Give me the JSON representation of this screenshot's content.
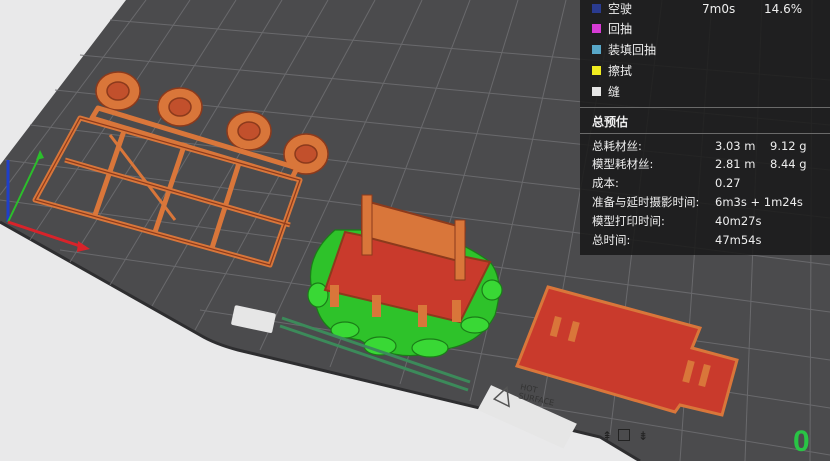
{
  "legend": {
    "items": [
      {
        "label": "空驶",
        "time": "7m0s",
        "percent": "14.6%",
        "color": "#2a3b8f"
      },
      {
        "label": "回抽",
        "color": "#d63bd4"
      },
      {
        "label": "装填回抽",
        "color": "#58a7c8"
      },
      {
        "label": "擦拭",
        "color": "#f0ec20"
      },
      {
        "label": "缝",
        "color": "#e6e6e6"
      }
    ]
  },
  "estimate": {
    "title": "总预估",
    "rows": [
      {
        "label": "总耗材丝:",
        "value1": "3.03 m",
        "value2": "9.12 g"
      },
      {
        "label": "模型耗材丝:",
        "value1": "2.81 m",
        "value2": "8.44 g"
      },
      {
        "label": "成本:",
        "value1": "0.27",
        "value2": ""
      },
      {
        "label": "准备与延时摄影时间:",
        "value1": "6m3s + 1m24s",
        "value2": ""
      },
      {
        "label": "模型打印时间:",
        "value1": "40m27s",
        "value2": ""
      },
      {
        "label": "总时间:",
        "value1": "47m54s",
        "value2": ""
      }
    ]
  },
  "bed": {
    "hot_surface_line1": "HOT",
    "hot_surface_line2": "SURFACE",
    "corner_digit": "0"
  },
  "colors": {
    "bed": "#4a4a4c",
    "grid": "#6a6a6c",
    "filament_orange": "#d9763a",
    "filament_red": "#c93a2c",
    "support_green": "#2ec22a"
  }
}
